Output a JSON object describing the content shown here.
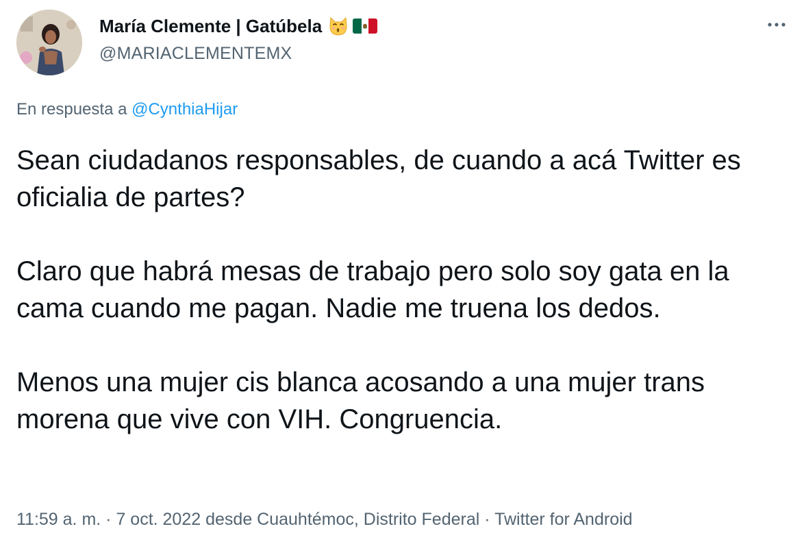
{
  "author": {
    "display_name": "María Clemente | Gatúbela",
    "handle": "@MARIACLEMENTEMX",
    "avatar": "profile-photo",
    "emojis": [
      "kissing-cat-emoji",
      "mexico-flag-emoji"
    ]
  },
  "menu": {
    "more_icon": "more-horizontal-icon"
  },
  "reply": {
    "prefix": "En respuesta a",
    "to_handle": "@CynthiaHijar"
  },
  "body": {
    "paragraphs": [
      "Sean ciudadanos responsables, de cuando a acá Twitter es oficialia de partes?",
      "Claro que habrá mesas de trabajo pero solo soy gata en la cama cuando me pagan. Nadie me truena los dedos.",
      "Menos una mujer cis blanca acosando a una mujer trans morena que vive con VIH. Congruencia."
    ]
  },
  "meta": {
    "time": "11:59 a. m.",
    "sep1": " · ",
    "date": "7 oct. 2022",
    "location": " desde Cuauhtémoc, Distrito Federal",
    "sep2": " · ",
    "source": "Twitter for Android"
  },
  "colors": {
    "text": "#0f1419",
    "secondary": "#536471",
    "link": "#1d9bf0",
    "background": "#ffffff"
  }
}
